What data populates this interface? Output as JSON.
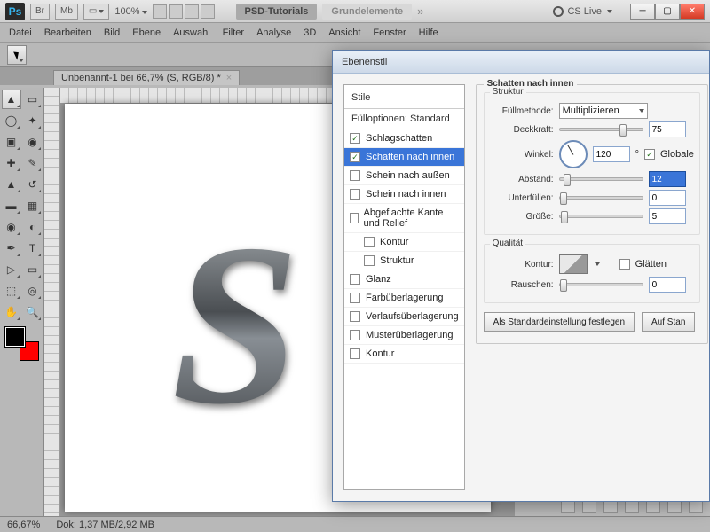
{
  "app": {
    "logo": "Ps",
    "br": "Br",
    "mb": "Mb",
    "zoom": "100%",
    "psd_tab": "PSD-Tutorials",
    "grund_tab": "Grundelemente",
    "cslive": "CS Live"
  },
  "menus": [
    "Datei",
    "Bearbeiten",
    "Bild",
    "Ebene",
    "Auswahl",
    "Filter",
    "Analyse",
    "3D",
    "Ansicht",
    "Fenster",
    "Hilfe"
  ],
  "doc": {
    "tab_label": "Unbenannt-1 bei 66,7% (S, RGB/8) *"
  },
  "status": {
    "zoom": "66,67%",
    "dok": "Dok: 1,37 MB/2,92 MB"
  },
  "dialog": {
    "title": "Ebenenstil",
    "styles_header": "Stile",
    "fill_opts": "Fülloptionen: Standard",
    "items": [
      {
        "label": "Schlagschatten",
        "checked": true,
        "selected": false
      },
      {
        "label": "Schatten nach innen",
        "checked": true,
        "selected": true
      },
      {
        "label": "Schein nach außen",
        "checked": false,
        "selected": false
      },
      {
        "label": "Schein nach innen",
        "checked": false,
        "selected": false
      },
      {
        "label": "Abgeflachte Kante und Relief",
        "checked": false,
        "selected": false
      },
      {
        "label": "Kontur",
        "checked": false,
        "selected": false,
        "indent": true
      },
      {
        "label": "Struktur",
        "checked": false,
        "selected": false,
        "indent": true
      },
      {
        "label": "Glanz",
        "checked": false,
        "selected": false
      },
      {
        "label": "Farbüberlagerung",
        "checked": false,
        "selected": false
      },
      {
        "label": "Verlaufsüberlagerung",
        "checked": false,
        "selected": false
      },
      {
        "label": "Musterüberlagerung",
        "checked": false,
        "selected": false
      },
      {
        "label": "Kontur",
        "checked": false,
        "selected": false
      }
    ],
    "group_title": "Schatten nach innen",
    "struktur_title": "Struktur",
    "fill_method_label": "Füllmethode:",
    "fill_method_value": "Multiplizieren",
    "opacity_label": "Deckkraft:",
    "opacity_value": "75",
    "angle_label": "Winkel:",
    "angle_value": "120",
    "angle_unit": "°",
    "global_label": "Globale",
    "distance_label": "Abstand:",
    "distance_value": "12",
    "choke_label": "Unterfüllen:",
    "choke_value": "0",
    "size_label": "Größe:",
    "size_value": "5",
    "quality_title": "Qualität",
    "contour_label": "Kontur:",
    "antialias_label": "Glätten",
    "noise_label": "Rauschen:",
    "noise_value": "0",
    "btn_default": "Als Standardeinstellung festlegen",
    "btn_reset": "Auf Stan"
  },
  "canvas": {
    "letter": "S"
  }
}
